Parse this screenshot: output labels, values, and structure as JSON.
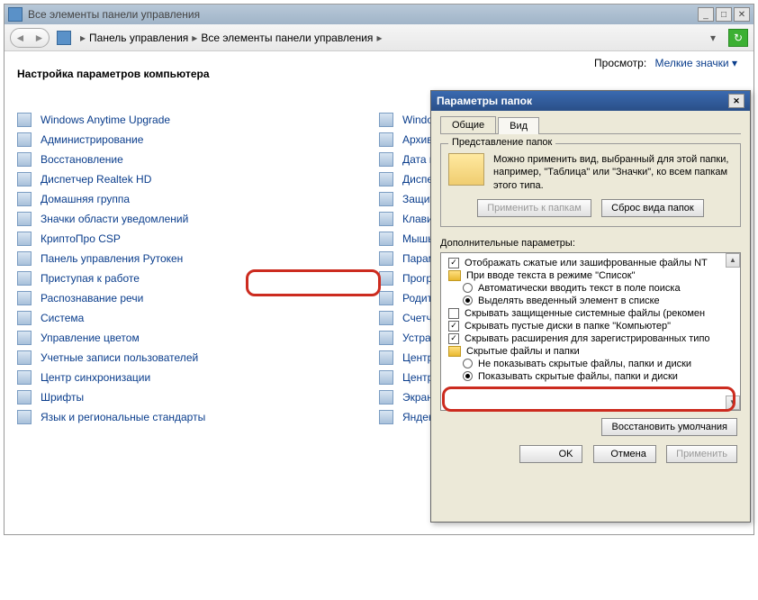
{
  "window": {
    "title": "Все элементы панели управления",
    "breadcrumb": [
      "Панель управления",
      "Все элементы панели управления"
    ],
    "heading": "Настройка параметров компьютера",
    "view_label": "Просмотр:",
    "view_value": "Мелкие значки"
  },
  "items_col1": [
    "Windows Anytime Upgrade",
    "Администрирование",
    "Восстановление",
    "Диспетчер Realtek HD",
    "Домашняя группа",
    "Значки области уведомлений",
    "КриптоПро CSP",
    "Панель управления Рутокен",
    "Приступая к работе",
    "Распознавание речи",
    "Система",
    "Управление цветом",
    "Учетные записи пользователей",
    "Центр синхронизации",
    "Шрифты",
    "Язык и региональные стандарты"
  ],
  "items_col2": [
    "Windows CardSpace",
    "Архивация и восстановление",
    "Дата и время",
    "Диспетчер устройств",
    "Защитник Windows",
    "Клавиатура",
    "Мышь",
    "Параметры папок",
    "Программы и компоненты",
    "Родительский контроль",
    "Счетчики и средства производите",
    "Устранение неполадок",
    "Центр обновления Windows",
    "Центр специальных возможносте",
    "Экран",
    "Яндекс.Диск"
  ],
  "dialog": {
    "title": "Параметры папок",
    "tabs": [
      "Общие",
      "Вид"
    ],
    "active_tab": 1,
    "group_legend": "Представление папок",
    "group_text": "Можно применить вид, выбранный для этой папки, например, \"Таблица\" или \"Значки\", ко всем папкам этого типа.",
    "apply_btn": "Применить к папкам",
    "reset_btn": "Сброс вида папок",
    "extra_label": "Дополнительные параметры:",
    "tree": [
      {
        "type": "check",
        "checked": true,
        "indent": 0,
        "text": "Отображать сжатые или зашифрованные файлы NT"
      },
      {
        "type": "folder",
        "indent": 0,
        "text": "При вводе текста в режиме \"Список\""
      },
      {
        "type": "radio",
        "checked": false,
        "indent": 1,
        "text": "Автоматически вводить текст в поле поиска"
      },
      {
        "type": "radio",
        "checked": true,
        "indent": 1,
        "text": "Выделять введенный элемент в списке"
      },
      {
        "type": "check",
        "checked": false,
        "indent": 0,
        "text": "Скрывать защищенные системные файлы (рекомен"
      },
      {
        "type": "check",
        "checked": true,
        "indent": 0,
        "text": "Скрывать пустые диски в папке \"Компьютер\""
      },
      {
        "type": "check",
        "checked": true,
        "indent": 0,
        "text": "Скрывать расширения для зарегистрированных типо"
      },
      {
        "type": "folder",
        "indent": 0,
        "text": "Скрытые файлы и папки"
      },
      {
        "type": "radio",
        "checked": false,
        "indent": 1,
        "text": "Не показывать скрытые файлы, папки и диски"
      },
      {
        "type": "radio",
        "checked": true,
        "indent": 1,
        "text": "Показывать скрытые файлы, папки и диски"
      }
    ],
    "restore_btn": "Восстановить умолчания",
    "ok": "OK",
    "cancel": "Отмена",
    "apply": "Применить"
  }
}
